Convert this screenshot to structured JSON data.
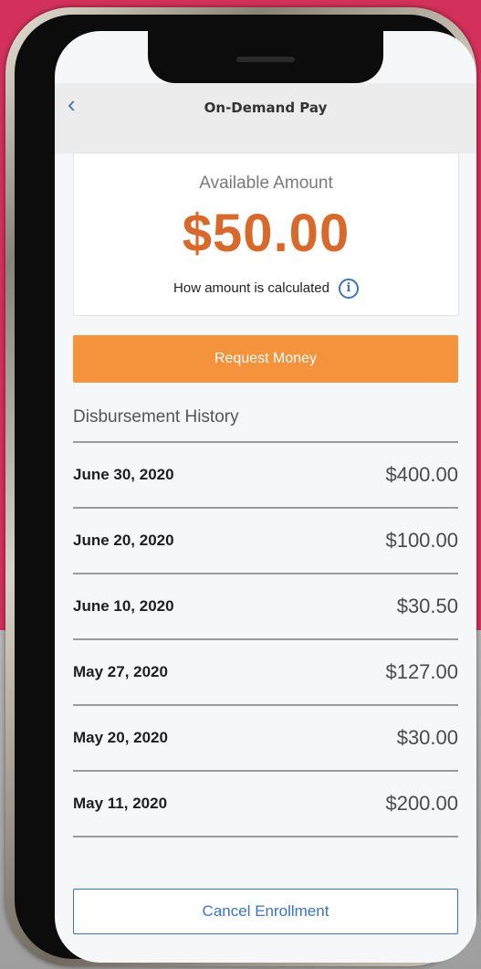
{
  "header": {
    "title": "On-Demand Pay",
    "back_icon": "‹"
  },
  "amount_card": {
    "label": "Available Amount",
    "value": "$50.00",
    "how_text": "How amount is calculated",
    "info_icon": "i"
  },
  "actions": {
    "request_label": "Request Money",
    "cancel_label": "Cancel Enrollment"
  },
  "history": {
    "title": "Disbursement History",
    "rows": [
      {
        "date": "June 30, 2020",
        "amount": "$400.00"
      },
      {
        "date": "June 20, 2020",
        "amount": "$100.00"
      },
      {
        "date": "June 10, 2020",
        "amount": "$30.50"
      },
      {
        "date": "May 27, 2020",
        "amount": "$127.00"
      },
      {
        "date": "May 20, 2020",
        "amount": "$30.00"
      },
      {
        "date": "May 11, 2020",
        "amount": "$200.00"
      }
    ]
  },
  "colors": {
    "accent_orange": "#f5923c",
    "amount_orange": "#d9692a",
    "link_blue": "#3a74c4"
  }
}
